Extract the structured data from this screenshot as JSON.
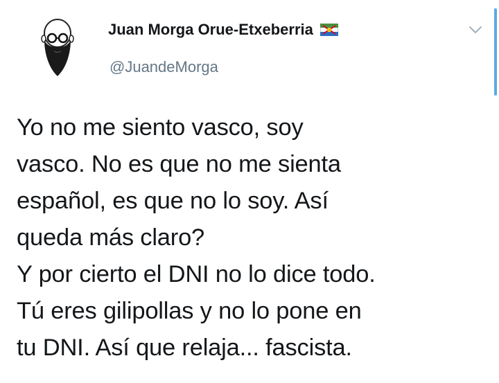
{
  "tweet": {
    "display_name": "Juan Morga Orue-Etxeberria",
    "handle": "@JuandeMorga",
    "lines": [
      "Yo no me siento vasco, soy",
      "vasco. No es que no me sienta",
      "español, es que no lo soy. Así",
      "queda más claro?",
      "Y por cierto el DNI no lo dice todo.",
      "Tú eres gilipollas y no lo pone en",
      "tu DNI. Así que relaja... fascista."
    ]
  },
  "icons": {
    "avatar": "bearded-man-with-glasses-avatar",
    "flag": "flag-icon",
    "menu": "chevron-down-icon"
  },
  "colors": {
    "text": "#14171a",
    "secondary_text": "#657786",
    "scroll_indicator": "#5aa9e6"
  }
}
